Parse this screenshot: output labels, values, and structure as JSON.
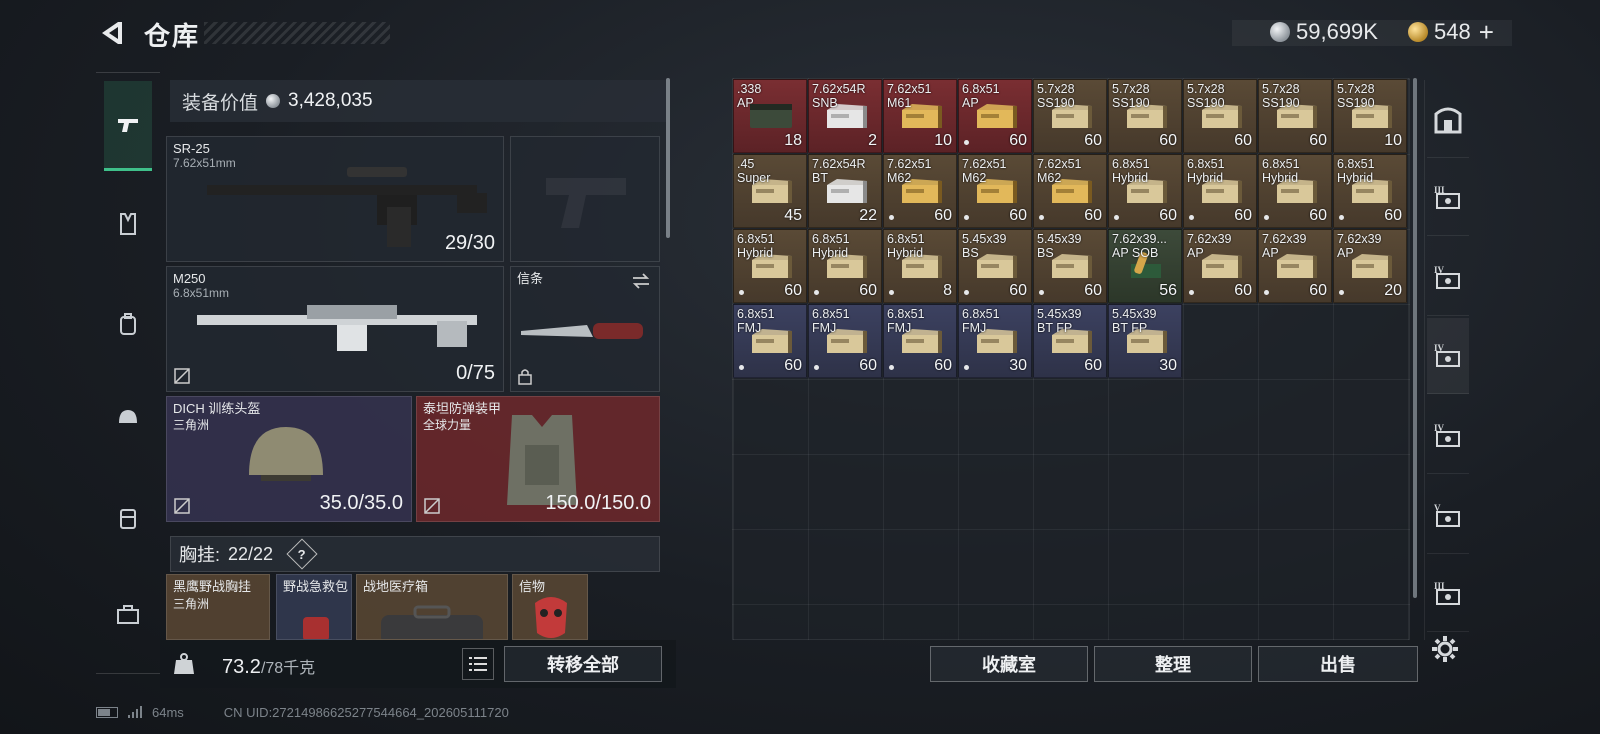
{
  "header": {
    "title": "仓库",
    "silver_amount": "59,699K",
    "gold_amount": "548",
    "gold_plus": "+"
  },
  "loadout": {
    "equipment_value_label": "装备价值",
    "equipment_value": "3,428,035",
    "primary": {
      "name": "SR-25",
      "caliber": "7.62x51mm",
      "ammo": "29/30"
    },
    "secondary": {
      "name": "M250",
      "caliber": "6.8x51mm",
      "ammo": "0/75"
    },
    "melee": {
      "label": "信条"
    },
    "helmet": {
      "name": "DICH 训练头盔",
      "brand": "三角洲",
      "durability": "35.0/35.0"
    },
    "armor": {
      "name": "泰坦防弹装甲",
      "brand": "全球力量",
      "durability": "150.0/150.0"
    },
    "chest_rig": {
      "label": "胸挂:",
      "capacity": "22/22",
      "help": "?"
    },
    "small_slots": [
      {
        "line1": "黑鹰野战胸挂",
        "line2": "三角洲"
      },
      {
        "line1": "野战急救包",
        "line2": ""
      },
      {
        "line1": "战地医疗箱",
        "line2": ""
      },
      {
        "line1": "信物",
        "line2": ""
      }
    ],
    "weight_current": "73.2",
    "weight_max": "/78千克",
    "transfer_all_label": "转移全部"
  },
  "stash": {
    "cells": [
      {
        "l1": ".338",
        "l2": "AP",
        "qty": "18",
        "color": "red",
        "dot": false,
        "icon": "ammo-crate-icon"
      },
      {
        "l1": "7.62x54R",
        "l2": "SNB",
        "qty": "2",
        "color": "red",
        "dot": false,
        "icon": "ammo-box-white-icon"
      },
      {
        "l1": "7.62x51",
        "l2": "M61",
        "qty": "10",
        "color": "red",
        "dot": false,
        "icon": "ammo-box-gold-icon"
      },
      {
        "l1": "6.8x51",
        "l2": "AP",
        "qty": "60",
        "color": "red",
        "dot": true,
        "icon": "ammo-box-gold-icon"
      },
      {
        "l1": "5.7x28",
        "l2": "SS190",
        "qty": "60",
        "color": "brown",
        "dot": false,
        "icon": "ammo-box-tan-icon"
      },
      {
        "l1": "5.7x28",
        "l2": "SS190",
        "qty": "60",
        "color": "brown",
        "dot": false,
        "icon": "ammo-box-tan-icon"
      },
      {
        "l1": "5.7x28",
        "l2": "SS190",
        "qty": "60",
        "color": "brown",
        "dot": false,
        "icon": "ammo-box-tan-icon"
      },
      {
        "l1": "5.7x28",
        "l2": "SS190",
        "qty": "60",
        "color": "brown",
        "dot": false,
        "icon": "ammo-box-tan-icon"
      },
      {
        "l1": "5.7x28",
        "l2": "SS190",
        "qty": "10",
        "color": "brown",
        "dot": false,
        "icon": "ammo-box-tan-icon"
      },
      {
        "l1": ".45",
        "l2": "Super",
        "qty": "45",
        "color": "brown",
        "dot": false,
        "icon": "ammo-box-tan-icon"
      },
      {
        "l1": "7.62x54R",
        "l2": "BT",
        "qty": "22",
        "color": "brown",
        "dot": false,
        "icon": "ammo-box-white-icon"
      },
      {
        "l1": "7.62x51",
        "l2": "M62",
        "qty": "60",
        "color": "brown",
        "dot": true,
        "icon": "ammo-box-gold-icon"
      },
      {
        "l1": "7.62x51",
        "l2": "M62",
        "qty": "60",
        "color": "brown",
        "dot": true,
        "icon": "ammo-box-gold-icon"
      },
      {
        "l1": "7.62x51",
        "l2": "M62",
        "qty": "60",
        "color": "brown",
        "dot": true,
        "icon": "ammo-box-gold-icon"
      },
      {
        "l1": "6.8x51",
        "l2": "Hybrid",
        "qty": "60",
        "color": "brown",
        "dot": true,
        "icon": "ammo-box-tan-icon"
      },
      {
        "l1": "6.8x51",
        "l2": "Hybrid",
        "qty": "60",
        "color": "brown",
        "dot": true,
        "icon": "ammo-box-tan-icon"
      },
      {
        "l1": "6.8x51",
        "l2": "Hybrid",
        "qty": "60",
        "color": "brown",
        "dot": true,
        "icon": "ammo-box-tan-icon"
      },
      {
        "l1": "6.8x51",
        "l2": "Hybrid",
        "qty": "60",
        "color": "brown",
        "dot": true,
        "icon": "ammo-box-tan-icon"
      },
      {
        "l1": "6.8x51",
        "l2": "Hybrid",
        "qty": "60",
        "color": "brown",
        "dot": true,
        "icon": "ammo-box-tan-icon"
      },
      {
        "l1": "6.8x51",
        "l2": "Hybrid",
        "qty": "60",
        "color": "brown",
        "dot": true,
        "icon": "ammo-box-tan-icon"
      },
      {
        "l1": "6.8x51",
        "l2": "Hybrid",
        "qty": "8",
        "color": "brown",
        "dot": true,
        "icon": "ammo-box-tan-icon"
      },
      {
        "l1": "5.45x39",
        "l2": "BS",
        "qty": "60",
        "color": "brown",
        "dot": true,
        "icon": "ammo-box-tan-icon"
      },
      {
        "l1": "5.45x39",
        "l2": "BS",
        "qty": "60",
        "color": "brown",
        "dot": true,
        "icon": "ammo-box-tan-icon"
      },
      {
        "l1": "7.62x39...",
        "l2": "AP SOB",
        "qty": "56",
        "color": "green",
        "dot": false,
        "icon": "ammo-round-icon"
      },
      {
        "l1": "7.62x39",
        "l2": "AP",
        "qty": "60",
        "color": "brown",
        "dot": true,
        "icon": "ammo-box-tan-icon"
      },
      {
        "l1": "7.62x39",
        "l2": "AP",
        "qty": "60",
        "color": "brown",
        "dot": true,
        "icon": "ammo-box-tan-icon"
      },
      {
        "l1": "7.62x39",
        "l2": "AP",
        "qty": "20",
        "color": "brown",
        "dot": true,
        "icon": "ammo-box-tan-icon"
      },
      {
        "l1": "6.8x51",
        "l2": "FMJ",
        "qty": "60",
        "color": "blue",
        "dot": true,
        "icon": "ammo-box-tan-icon"
      },
      {
        "l1": "6.8x51",
        "l2": "FMJ",
        "qty": "60",
        "color": "blue",
        "dot": true,
        "icon": "ammo-box-tan-icon"
      },
      {
        "l1": "6.8x51",
        "l2": "FMJ",
        "qty": "60",
        "color": "blue",
        "dot": true,
        "icon": "ammo-box-tan-icon"
      },
      {
        "l1": "6.8x51",
        "l2": "FMJ",
        "qty": "30",
        "color": "blue",
        "dot": true,
        "icon": "ammo-box-tan-icon"
      },
      {
        "l1": "5.45x39",
        "l2": "BT FP",
        "qty": "60",
        "color": "blue",
        "dot": false,
        "icon": "ammo-box-tan-icon"
      },
      {
        "l1": "5.45x39",
        "l2": "BT FP",
        "qty": "30",
        "color": "blue",
        "dot": false,
        "icon": "ammo-box-tan-icon"
      }
    ],
    "collection_label": "收藏室",
    "organize_label": "整理",
    "sell_label": "出售"
  },
  "right_tabs": [
    {
      "icon": "safe-icon"
    },
    {
      "icon": "stash-iii-icon",
      "tier": "III"
    },
    {
      "icon": "stash-iv-icon",
      "tier": "IV"
    },
    {
      "icon": "stash-iv-folder-icon",
      "tier": "IV"
    },
    {
      "icon": "stash-iv-icon",
      "tier": "IV"
    },
    {
      "icon": "stash-v-icon",
      "tier": "V"
    },
    {
      "icon": "stash-iii-icon",
      "tier": "III"
    }
  ],
  "status": {
    "ping": "64ms",
    "uid": "CN UID:27214986625277544664_202605111720"
  }
}
